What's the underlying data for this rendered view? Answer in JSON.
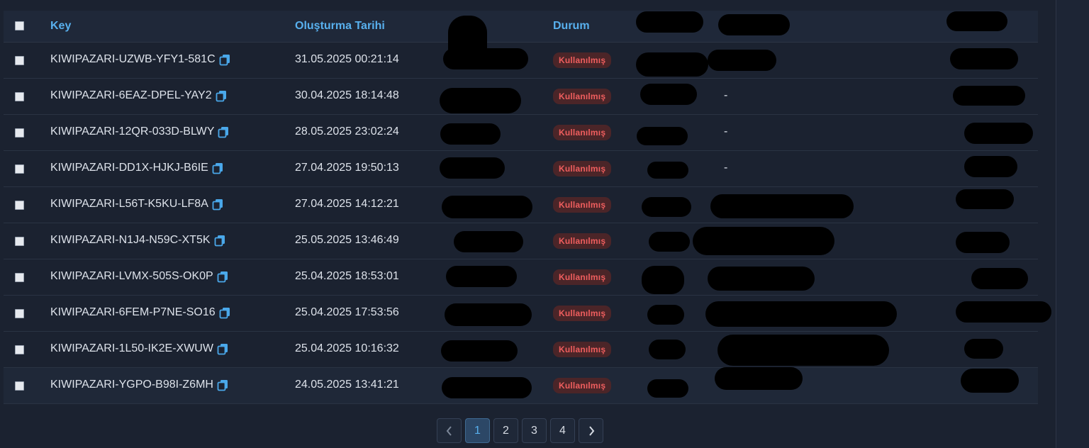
{
  "table": {
    "columns": {
      "key": "Key",
      "created": "Oluşturma Tarihi",
      "status": "Durum"
    },
    "rows": [
      {
        "key": "KIWIPAZARI-UZWB-YFY1-581C",
        "created": "31.05.2025 00:21:14",
        "status": "Kullanılmış",
        "detail": ""
      },
      {
        "key": "KIWIPAZARI-6EAZ-DPEL-YAY2",
        "created": "30.04.2025 18:14:48",
        "status": "Kullanılmış",
        "detail": "-"
      },
      {
        "key": "KIWIPAZARI-12QR-033D-BLWY",
        "created": "28.05.2025 23:02:24",
        "status": "Kullanılmış",
        "detail": "-"
      },
      {
        "key": "KIWIPAZARI-DD1X-HJKJ-B6IE",
        "created": "27.04.2025 19:50:13",
        "status": "Kullanılmış",
        "detail": "-"
      },
      {
        "key": "KIWIPAZARI-L56T-K5KU-LF8A",
        "created": "27.04.2025 14:12:21",
        "status": "Kullanılmış",
        "detail": ""
      },
      {
        "key": "KIWIPAZARI-N1J4-N59C-XT5K",
        "created": "25.05.2025 13:46:49",
        "status": "Kullanılmış",
        "detail": ""
      },
      {
        "key": "KIWIPAZARI-LVMX-505S-OK0P",
        "created": "25.04.2025 18:53:01",
        "status": "Kullanılmış",
        "detail": ""
      },
      {
        "key": "KIWIPAZARI-6FEM-P7NE-SO16",
        "created": "25.04.2025 17:53:56",
        "status": "Kullanılmış",
        "detail": ""
      },
      {
        "key": "KIWIPAZARI-1L50-IK2E-XWUW",
        "created": "25.04.2025 10:16:32",
        "status": "Kullanılmış",
        "detail": ""
      },
      {
        "key": "KIWIPAZARI-YGPO-B98I-Z6MH",
        "created": "24.05.2025 13:41:21",
        "status": "Kullanılmış",
        "detail": ""
      }
    ]
  },
  "pagination": {
    "pages": [
      "1",
      "2",
      "3",
      "4"
    ],
    "active": "1",
    "prev_icon": "chevron-left-icon",
    "next_icon": "chevron-right-icon"
  },
  "colors": {
    "background": "#1b2230",
    "header_text": "#58b0ee",
    "badge_bg": "#4b2528",
    "badge_text": "#ef5e5e"
  }
}
